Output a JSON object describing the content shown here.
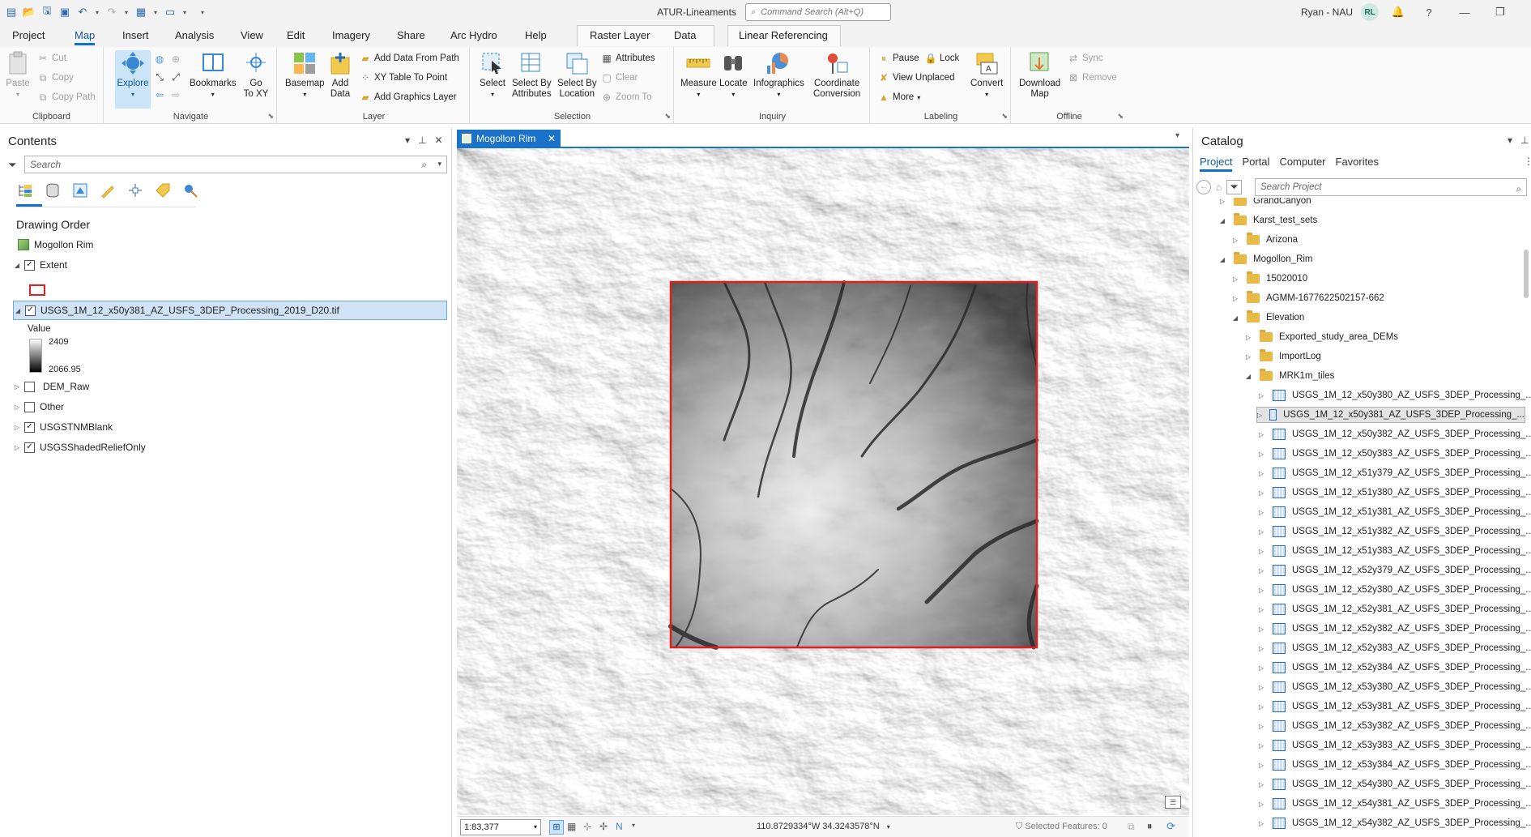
{
  "window": {
    "title": "ATUR-Lineaments",
    "command_search_placeholder": "Command Search (Alt+Q)",
    "user_name": "Ryan - NAU",
    "user_initials": "RL"
  },
  "ribbon_tabs": [
    "Project",
    "Map",
    "Insert",
    "Analysis",
    "View",
    "Edit",
    "Imagery",
    "Share",
    "Arc Hydro",
    "Help",
    "Raster Layer",
    "Data",
    "Linear Referencing"
  ],
  "active_tab": "Map",
  "ribbon": {
    "clipboard": {
      "label": "Clipboard",
      "paste": "Paste",
      "cut": "Cut",
      "copy": "Copy",
      "copy_path": "Copy Path"
    },
    "navigate": {
      "label": "Navigate",
      "explore": "Explore",
      "bookmarks": "Bookmarks",
      "go_to_xy_1": "Go",
      "go_to_xy_2": "To XY"
    },
    "layer": {
      "label": "Layer",
      "basemap": "Basemap",
      "add_data_1": "Add",
      "add_data_2": "Data",
      "add_from_path": "Add Data From Path",
      "xy_table": "XY Table To Point",
      "add_graphics": "Add Graphics Layer"
    },
    "selection": {
      "label": "Selection",
      "select": "Select",
      "select_by_attr_1": "Select By",
      "select_by_attr_2": "Attributes",
      "select_by_loc_1": "Select By",
      "select_by_loc_2": "Location",
      "attributes": "Attributes",
      "clear": "Clear",
      "zoom_to": "Zoom To"
    },
    "inquiry": {
      "label": "Inquiry",
      "measure": "Measure",
      "locate": "Locate",
      "infographics": "Infographics",
      "coord_conv_1": "Coordinate",
      "coord_conv_2": "Conversion"
    },
    "labeling": {
      "label": "Labeling",
      "pause": "Pause",
      "lock": "Lock",
      "view_unplaced": "View Unplaced",
      "more": "More",
      "convert": "Convert"
    },
    "offline": {
      "label": "Offline",
      "download_1": "Download",
      "download_2": "Map",
      "sync": "Sync",
      "remove": "Remove"
    }
  },
  "contents": {
    "title": "Contents",
    "search_placeholder": "Search",
    "drawing_order": "Drawing Order",
    "map_name": "Mogollon Rim",
    "layers": {
      "extent": "Extent",
      "dem_tile": "USGS_1M_12_x50y381_AZ_USFS_3DEP_Processing_2019_D20.tif",
      "value_label": "Value",
      "value_max": "2409",
      "value_min": "2066.95",
      "dem_raw": "DEM_Raw",
      "other": "Other",
      "usgs_blank": "USGSTNMBlank",
      "usgs_relief": "USGSShadedReliefOnly"
    }
  },
  "map": {
    "tab_title": "Mogollon Rim",
    "scale": "1:83,377",
    "coordinates": "110.8729334°W 34.3243578°N",
    "selected_features": "Selected Features: 0",
    "extent_color": "#e02020"
  },
  "catalog": {
    "title": "Catalog",
    "tabs": [
      "Project",
      "Portal",
      "Computer",
      "Favorites"
    ],
    "search_placeholder": "Search Project",
    "tree": [
      {
        "label": "GrandCanyon",
        "level": 2,
        "kind": "folder",
        "exp": "closed"
      },
      {
        "label": "Karst_test_sets",
        "level": 2,
        "kind": "folder",
        "exp": "open"
      },
      {
        "label": "Arizona",
        "level": 3,
        "kind": "folder",
        "exp": "closed"
      },
      {
        "label": "Mogollon_Rim",
        "level": 2,
        "kind": "folder",
        "exp": "open"
      },
      {
        "label": "15020010",
        "level": 3,
        "kind": "folder",
        "exp": "closed"
      },
      {
        "label": "AGMM-1677622502157-662",
        "level": 3,
        "kind": "folder",
        "exp": "closed"
      },
      {
        "label": "Elevation",
        "level": 3,
        "kind": "folder",
        "exp": "open"
      },
      {
        "label": "Exported_study_area_DEMs",
        "level": 4,
        "kind": "folder",
        "exp": "closed"
      },
      {
        "label": "ImportLog",
        "level": 4,
        "kind": "folder",
        "exp": "closed"
      },
      {
        "label": "MRK1m_tiles",
        "level": 4,
        "kind": "folder",
        "exp": "open"
      },
      {
        "label": "USGS_1M_12_x50y380_AZ_USFS_3DEP_Processing_...",
        "level": 5,
        "kind": "raster",
        "exp": "closed"
      },
      {
        "label": "USGS_1M_12_x50y381_AZ_USFS_3DEP_Processing_...",
        "level": 5,
        "kind": "raster",
        "exp": "closed",
        "selected": true
      },
      {
        "label": "USGS_1M_12_x50y382_AZ_USFS_3DEP_Processing_...",
        "level": 5,
        "kind": "raster",
        "exp": "closed"
      },
      {
        "label": "USGS_1M_12_x50y383_AZ_USFS_3DEP_Processing_...",
        "level": 5,
        "kind": "raster",
        "exp": "closed"
      },
      {
        "label": "USGS_1M_12_x51y379_AZ_USFS_3DEP_Processing_...",
        "level": 5,
        "kind": "raster",
        "exp": "closed"
      },
      {
        "label": "USGS_1M_12_x51y380_AZ_USFS_3DEP_Processing_...",
        "level": 5,
        "kind": "raster",
        "exp": "closed"
      },
      {
        "label": "USGS_1M_12_x51y381_AZ_USFS_3DEP_Processing_...",
        "level": 5,
        "kind": "raster",
        "exp": "closed"
      },
      {
        "label": "USGS_1M_12_x51y382_AZ_USFS_3DEP_Processing_...",
        "level": 5,
        "kind": "raster",
        "exp": "closed"
      },
      {
        "label": "USGS_1M_12_x51y383_AZ_USFS_3DEP_Processing_...",
        "level": 5,
        "kind": "raster",
        "exp": "closed"
      },
      {
        "label": "USGS_1M_12_x52y379_AZ_USFS_3DEP_Processing_...",
        "level": 5,
        "kind": "raster",
        "exp": "closed"
      },
      {
        "label": "USGS_1M_12_x52y380_AZ_USFS_3DEP_Processing_...",
        "level": 5,
        "kind": "raster",
        "exp": "closed"
      },
      {
        "label": "USGS_1M_12_x52y381_AZ_USFS_3DEP_Processing_...",
        "level": 5,
        "kind": "raster",
        "exp": "closed"
      },
      {
        "label": "USGS_1M_12_x52y382_AZ_USFS_3DEP_Processing_...",
        "level": 5,
        "kind": "raster",
        "exp": "closed"
      },
      {
        "label": "USGS_1M_12_x52y383_AZ_USFS_3DEP_Processing_...",
        "level": 5,
        "kind": "raster",
        "exp": "closed"
      },
      {
        "label": "USGS_1M_12_x52y384_AZ_USFS_3DEP_Processing_...",
        "level": 5,
        "kind": "raster",
        "exp": "closed"
      },
      {
        "label": "USGS_1M_12_x53y380_AZ_USFS_3DEP_Processing_...",
        "level": 5,
        "kind": "raster",
        "exp": "closed"
      },
      {
        "label": "USGS_1M_12_x53y381_AZ_USFS_3DEP_Processing_...",
        "level": 5,
        "kind": "raster",
        "exp": "closed"
      },
      {
        "label": "USGS_1M_12_x53y382_AZ_USFS_3DEP_Processing_...",
        "level": 5,
        "kind": "raster",
        "exp": "closed"
      },
      {
        "label": "USGS_1M_12_x53y383_AZ_USFS_3DEP_Processing_...",
        "level": 5,
        "kind": "raster",
        "exp": "closed"
      },
      {
        "label": "USGS_1M_12_x53y384_AZ_USFS_3DEP_Processing_...",
        "level": 5,
        "kind": "raster",
        "exp": "closed"
      },
      {
        "label": "USGS_1M_12_x54y380_AZ_USFS_3DEP_Processing_...",
        "level": 5,
        "kind": "raster",
        "exp": "closed"
      },
      {
        "label": "USGS_1M_12_x54y381_AZ_USFS_3DEP_Processing_...",
        "level": 5,
        "kind": "raster",
        "exp": "closed"
      },
      {
        "label": "USGS_1M_12_x54y382_AZ_USFS_3DEP_Processing_...",
        "level": 5,
        "kind": "raster",
        "exp": "closed"
      }
    ]
  }
}
